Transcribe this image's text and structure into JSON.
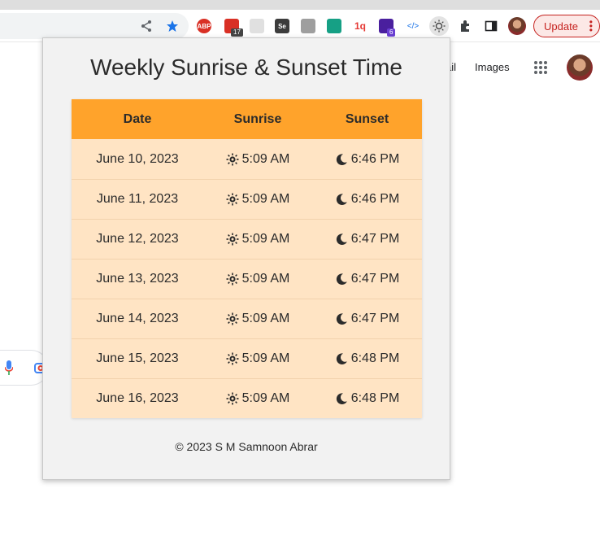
{
  "browser": {
    "update_label": "Update",
    "ext_badges": {
      "calendar": "17",
      "shortcut": "6"
    },
    "ext_labels": {
      "abp": "ABP",
      "selenium": "Se"
    }
  },
  "background_page": {
    "links": [
      "ail",
      "Images"
    ]
  },
  "popup": {
    "title": "Weekly Sunrise & Sunset Time",
    "headers": {
      "date": "Date",
      "sunrise": "Sunrise",
      "sunset": "Sunset"
    },
    "rows": [
      {
        "date": "June 10, 2023",
        "sunrise": "5:09 AM",
        "sunset": "6:46 PM"
      },
      {
        "date": "June 11, 2023",
        "sunrise": "5:09 AM",
        "sunset": "6:46 PM"
      },
      {
        "date": "June 12, 2023",
        "sunrise": "5:09 AM",
        "sunset": "6:47 PM"
      },
      {
        "date": "June 13, 2023",
        "sunrise": "5:09 AM",
        "sunset": "6:47 PM"
      },
      {
        "date": "June 14, 2023",
        "sunrise": "5:09 AM",
        "sunset": "6:47 PM"
      },
      {
        "date": "June 15, 2023",
        "sunrise": "5:09 AM",
        "sunset": "6:48 PM"
      },
      {
        "date": "June 16, 2023",
        "sunrise": "5:09 AM",
        "sunset": "6:48 PM"
      }
    ],
    "footer": "© 2023 S M Samnoon Abrar"
  },
  "icons": {
    "sunrise": "sun-icon",
    "sunset": "moon-icon"
  },
  "colors": {
    "header_bg": "#ffa32b",
    "row_bg": "#ffe4c4",
    "popup_bg": "#f2f2f2",
    "update_accent": "#c5221f"
  }
}
